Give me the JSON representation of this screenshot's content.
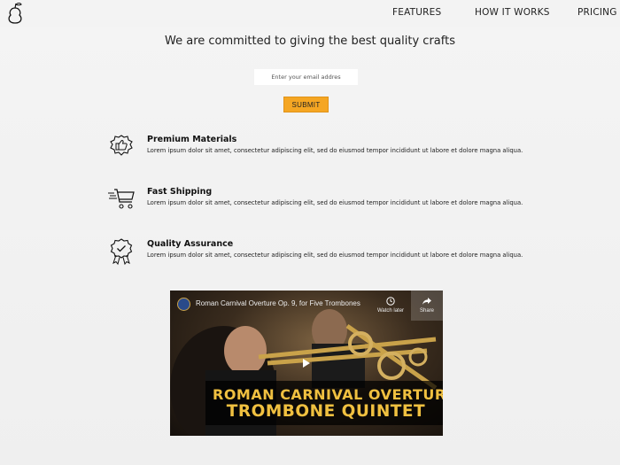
{
  "nav": {
    "links": [
      "FEATURES",
      "HOW IT WORKS",
      "PRICING"
    ]
  },
  "hero": {
    "headline": "We are committed to giving the best quality crafts",
    "email_placeholder": "Enter your email addres",
    "submit_label": "SUBMIT"
  },
  "features": [
    {
      "icon": "thumbs-up-badge-icon",
      "title": "Premium Materials",
      "description": "Lorem ipsum dolor sit amet, consectetur adipiscing elit, sed do eiusmod tempor incididunt ut labore et dolore magna aliqua."
    },
    {
      "icon": "fast-cart-icon",
      "title": "Fast Shipping",
      "description": "Lorem ipsum dolor sit amet, consectetur adipiscing elit, sed do eiusmod tempor incididunt ut labore et dolore magna aliqua."
    },
    {
      "icon": "award-ribbon-icon",
      "title": "Quality Assurance",
      "description": "Lorem ipsum dolor sit amet, consectetur adipiscing elit, sed do eiusmod tempor incididunt ut labore et dolore magna aliqua."
    }
  ],
  "video": {
    "title": "Roman Carnival Overture Op. 9, for Five Trombones",
    "watch_later": "Watch later",
    "share": "Share",
    "banner_line1": "ROMAN CARNIVAL OVERTURE",
    "banner_line2": "TROMBONE QUINTET"
  },
  "colors": {
    "accent": "#f5a623",
    "banner_text": "#f0c040"
  }
}
